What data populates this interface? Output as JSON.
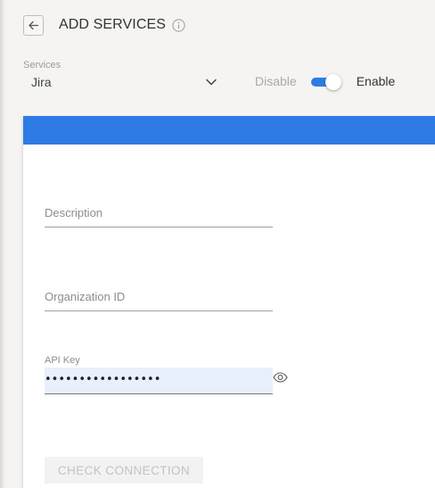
{
  "header": {
    "title": "ADD SERVICES",
    "back_icon": "arrow-left-icon",
    "info_icon": "info-icon"
  },
  "services": {
    "label": "Services",
    "selected": "Jira",
    "dropdown_icon": "chevron-down-icon"
  },
  "status_toggle": {
    "off_label": "Disable",
    "on_label": "Enable",
    "enabled": true,
    "accent_color": "#2f7be5"
  },
  "form": {
    "band_color": "#2f7be5",
    "description": {
      "placeholder": "Description",
      "value": ""
    },
    "organization_id": {
      "placeholder": "Organization ID",
      "value": ""
    },
    "api_key": {
      "label": "API Key",
      "masked_value": "•••••••••••••••••",
      "visibility_icon": "eye-icon"
    },
    "check_connection_label": "CHECK CONNECTION",
    "check_connection_enabled": false
  }
}
